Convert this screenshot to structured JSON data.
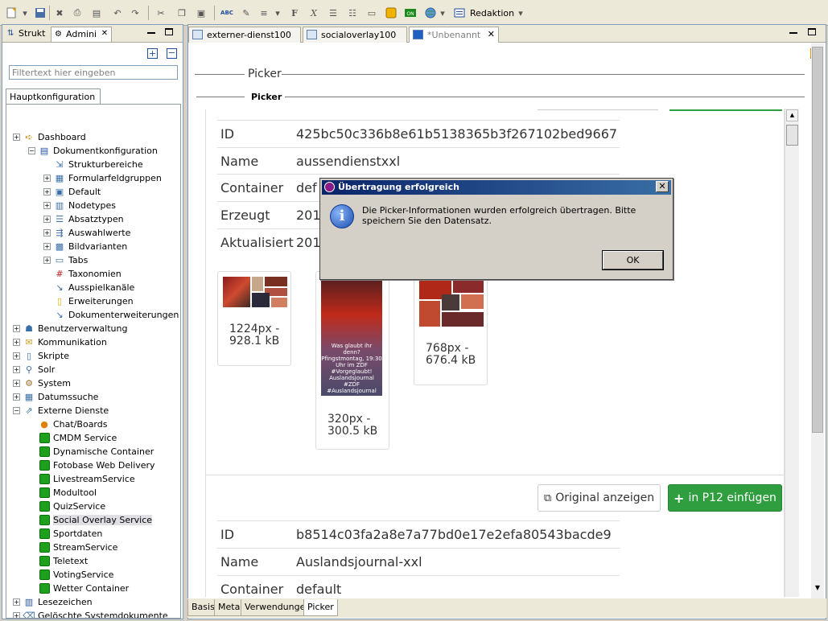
{
  "toolbar": {
    "redaktion_label": "Redaktion",
    "format_bold": "F",
    "format_italic": "X",
    "abc_label": "ABC"
  },
  "left_panel": {
    "tabs": [
      {
        "label": "Strukt"
      },
      {
        "label": "Admini"
      }
    ],
    "filter_placeholder": "Filtertext hier eingeben",
    "subtab": "Hauptkonfiguration",
    "tree": [
      {
        "label": "Dashboard"
      },
      {
        "label": "Dokumentkonfiguration"
      },
      {
        "label": "Strukturbereiche"
      },
      {
        "label": "Formularfeldgruppen"
      },
      {
        "label": "Default"
      },
      {
        "label": "Nodetypes"
      },
      {
        "label": "Absatztypen"
      },
      {
        "label": "Auswahlwerte"
      },
      {
        "label": "Bildvarianten"
      },
      {
        "label": "Tabs"
      },
      {
        "label": "Taxonomien"
      },
      {
        "label": "Ausspielkanäle"
      },
      {
        "label": "Erweiterungen"
      },
      {
        "label": "Dokumenterweiterungen"
      },
      {
        "label": "Benutzerverwaltung"
      },
      {
        "label": "Kommunikation"
      },
      {
        "label": "Skripte"
      },
      {
        "label": "Solr"
      },
      {
        "label": "System"
      },
      {
        "label": "Datumssuche"
      },
      {
        "label": "Externe Dienste"
      },
      {
        "label": "Chat/Boards"
      },
      {
        "label": "CMDM Service"
      },
      {
        "label": "Dynamische Container"
      },
      {
        "label": "Fotobase Web Delivery"
      },
      {
        "label": "LivestreamService"
      },
      {
        "label": "Modultool"
      },
      {
        "label": "QuizService"
      },
      {
        "label": "Social Overlay Service"
      },
      {
        "label": "Sportdaten"
      },
      {
        "label": "StreamService"
      },
      {
        "label": "Teletext"
      },
      {
        "label": "VotingService"
      },
      {
        "label": "Wetter Container"
      },
      {
        "label": "Lesezeichen"
      },
      {
        "label": "Gelöschte Systemdokumente"
      }
    ]
  },
  "editor": {
    "tabs": [
      {
        "label": "externer-dienst100"
      },
      {
        "label": "socialoverlay100"
      },
      {
        "label": "*Unbenannt"
      }
    ],
    "section_title": "Picker",
    "subsection_title": "Picker",
    "record1": {
      "fields": [
        {
          "key": "ID",
          "value": "425bc50c336b8e61b5138365b3f267102bed9667"
        },
        {
          "key": "Name",
          "value": "aussendienstxxl"
        },
        {
          "key": "Container",
          "value": "def"
        },
        {
          "key": "Erzeugt",
          "value": "201"
        },
        {
          "key": "Aktualisiert",
          "value": "201"
        }
      ],
      "thumbs": [
        {
          "size": "1224px -",
          "kb": "928.1 kB"
        },
        {
          "size": "320px -",
          "kb": "300.5 kB"
        },
        {
          "size": "768px -",
          "kb": "676.4 kB"
        }
      ],
      "thumb2_overlay": [
        "Was glaubt ihr",
        "denn?",
        "Pfingstmontag, 19:30",
        "Uhr im ZDF",
        "#Vorgeglaubt!",
        "Auslandsjournal",
        "#ZDF",
        "#Auslandsjournal"
      ]
    },
    "buttons": {
      "original": "Original anzeigen",
      "insert": "in P12 einfügen"
    },
    "record2": {
      "fields": [
        {
          "key": "ID",
          "value": "b8514c03fa2a8e7a77bd0e17e2efa80543bacde9"
        },
        {
          "key": "Name",
          "value": "Auslandsjournal-xxl"
        },
        {
          "key": "Container",
          "value": "default"
        }
      ]
    },
    "bottom_tabs": [
      {
        "label": "Basis"
      },
      {
        "label": "Meta"
      },
      {
        "label": "Verwendungen"
      },
      {
        "label": "Picker"
      }
    ]
  },
  "dialog": {
    "title": "Übertragung erfolgreich",
    "message": "Die Picker-Informationen wurden erfolgreich übertragen. Bitte speichern Sie den Datensatz.",
    "ok": "OK"
  },
  "colors": {
    "insert_button": "#2e9e3e",
    "dialog_title_start": "#0a246a",
    "dialog_title_end": "#3a6ea5",
    "service_icon": "#1da11d"
  }
}
